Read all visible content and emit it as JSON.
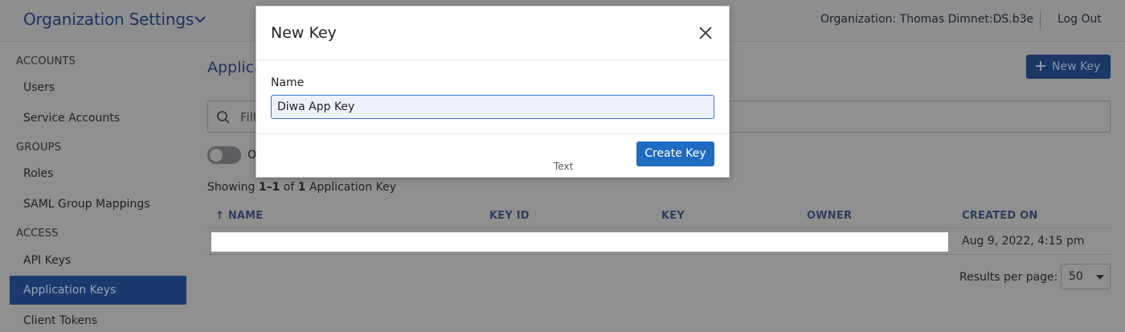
{
  "header": {
    "title": "Organization Settings",
    "org_label": "Organization: Thomas Dimnet:DS.b3e",
    "logout": "Log Out"
  },
  "sidebar": {
    "sections": [
      {
        "label": "ACCOUNTS",
        "items": [
          "Users",
          "Service Accounts"
        ]
      },
      {
        "label": "GROUPS",
        "items": [
          "Roles",
          "SAML Group Mappings"
        ]
      },
      {
        "label": "ACCESS",
        "items": [
          "API Keys",
          "Application Keys",
          "Client Tokens"
        ]
      }
    ],
    "active_item": "Application Keys"
  },
  "main": {
    "title_visible": "Applica",
    "new_key_label": "New Key",
    "filter_placeholder_visible": "Filt",
    "toggle_label_visible": "O",
    "showing_prefix": "Showing ",
    "showing_range": "1–1",
    "showing_of": " of ",
    "showing_total": "1",
    "showing_suffix": " Application Key",
    "table": {
      "columns": [
        "↑ NAME",
        "KEY ID",
        "KEY",
        "OWNER",
        "CREATED ON"
      ],
      "rows": [
        {
          "created_on": "Aug 9, 2022, 4:15 pm"
        }
      ]
    },
    "results_per_page_label": "Results per page:",
    "results_per_page_value": "50"
  },
  "modal": {
    "title": "New Key",
    "name_label": "Name",
    "name_value": "Diwa App Key",
    "create_button": "Create Key",
    "annotation": "Text"
  },
  "colors": {
    "active_sidebar": "#1c3a6d",
    "primary_button": "#1e6bc2",
    "overlay": "#8f8f8f"
  }
}
